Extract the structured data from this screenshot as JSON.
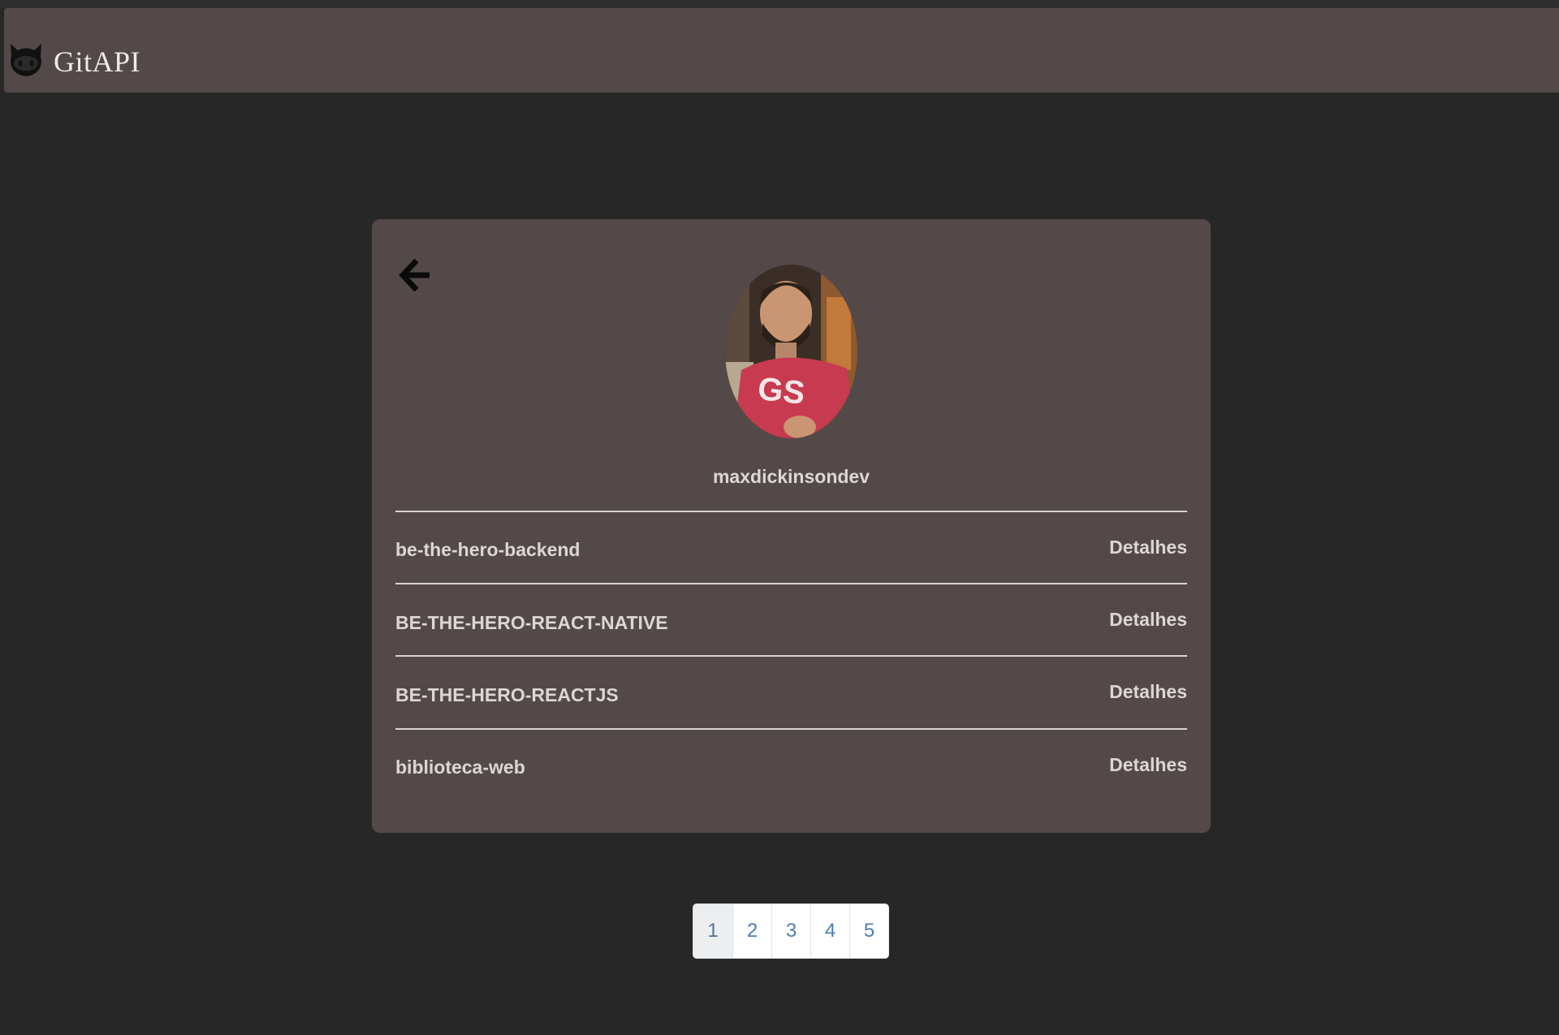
{
  "navbar": {
    "brand_icon": "github-octocat-icon",
    "title": "GitAPI"
  },
  "profile": {
    "back_icon": "arrow-left-icon",
    "avatar": "user-avatar-photo",
    "username": "maxdickinsondev"
  },
  "repos": [
    {
      "name": "be-the-hero-backend",
      "action": "Detalhes"
    },
    {
      "name": "BE-THE-HERO-REACT-NATIVE",
      "action": "Detalhes"
    },
    {
      "name": "BE-THE-HERO-REACTJS",
      "action": "Detalhes"
    },
    {
      "name": "biblioteca-web",
      "action": "Detalhes"
    }
  ],
  "pagination": {
    "pages": [
      "1",
      "2",
      "3",
      "4",
      "5"
    ],
    "active": "1"
  },
  "colors": {
    "background": "#272727",
    "surface": "#534949",
    "text": "#ddd6d6",
    "link": "#4c7cb5"
  }
}
